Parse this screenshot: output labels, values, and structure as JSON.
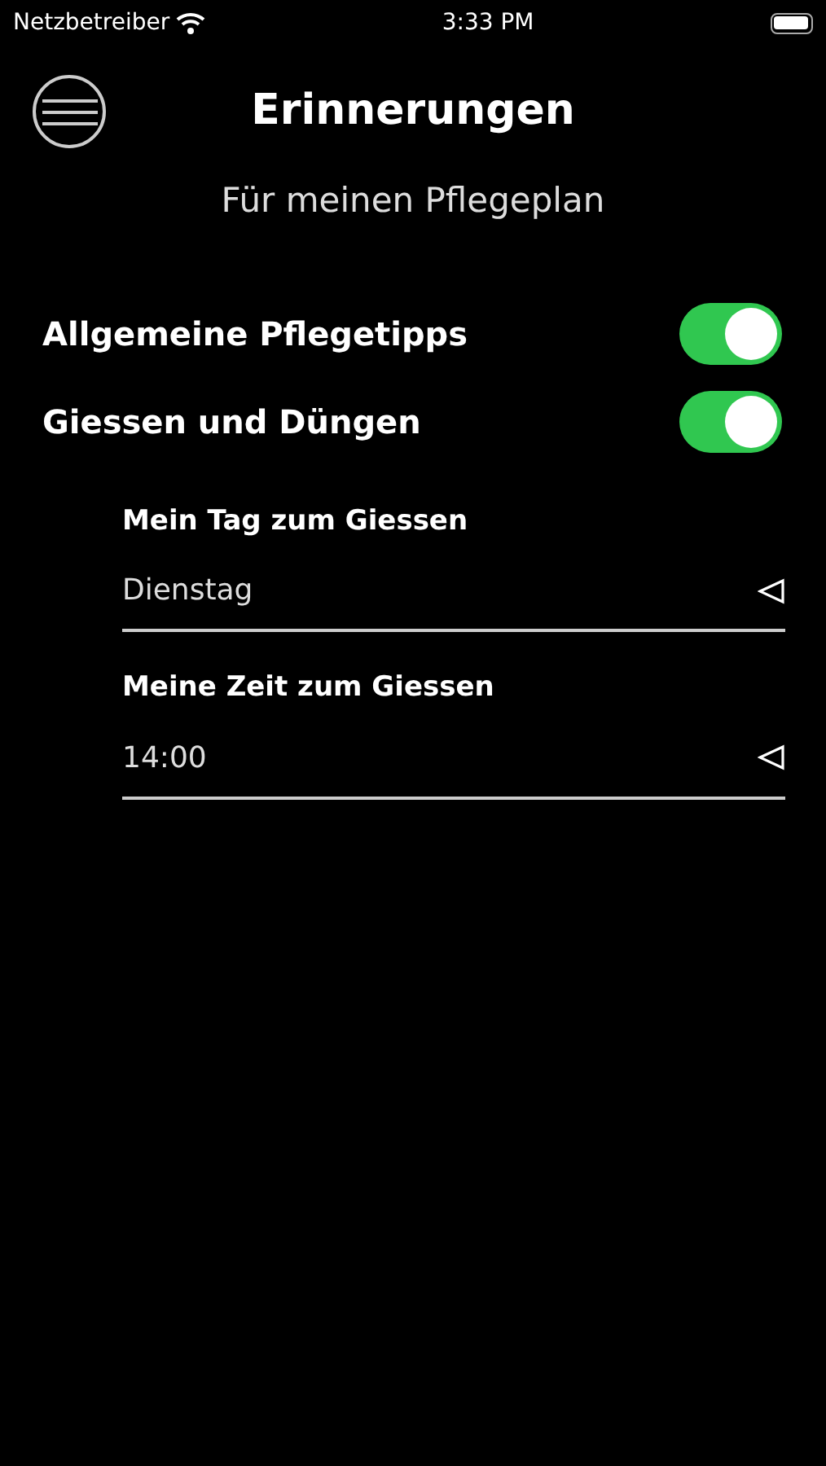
{
  "status_bar": {
    "carrier": "Netzbetreiber",
    "time": "3:33 PM"
  },
  "header": {
    "title": "Erinnerungen",
    "subtitle": "Für meinen Pflegeplan"
  },
  "toggles": [
    {
      "label": "Allgemeine Pflegetipps",
      "on": true
    },
    {
      "label": "Giessen und Düngen",
      "on": true
    }
  ],
  "pickers": [
    {
      "label": "Mein Tag zum Giessen",
      "value": "Dienstag"
    },
    {
      "label": "Meine Zeit zum Giessen",
      "value": "14:00"
    }
  ]
}
